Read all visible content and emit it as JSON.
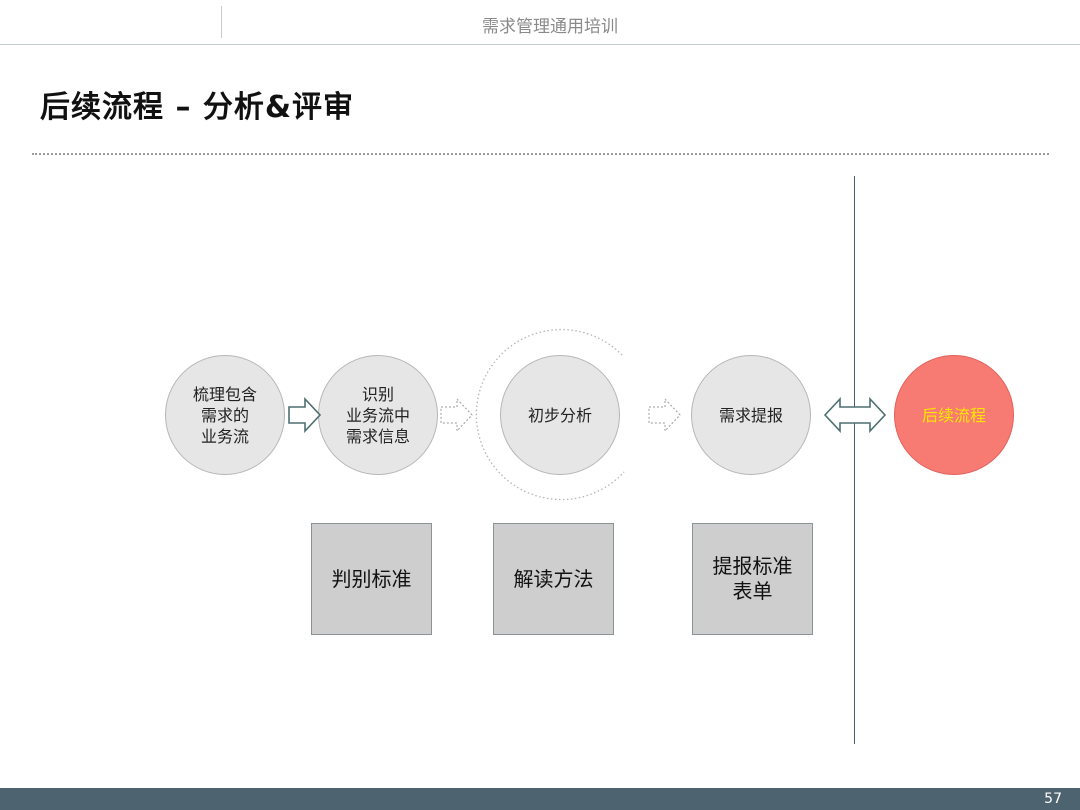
{
  "header": {
    "title": "需求管理通用培训"
  },
  "slide": {
    "title": "后续流程 – 分析&评审"
  },
  "process": {
    "steps": [
      {
        "label": "梳理包含\n需求的\n业务流"
      },
      {
        "label": "识别\n业务流中\n需求信息"
      },
      {
        "label": "初步分析"
      },
      {
        "label": "需求提报"
      },
      {
        "label": "后续流程"
      }
    ],
    "boxes": [
      {
        "label": "判别标准"
      },
      {
        "label": "解读方法"
      },
      {
        "label": "提报标准\n表单"
      }
    ]
  },
  "colors": {
    "step_fill": "#e6e6e6",
    "final_fill": "#f77a73",
    "final_text": "#ffe600",
    "box_fill": "#cecece",
    "footer": "#4e6370",
    "arrow_outline": "#4e6f70"
  },
  "footer": {
    "page_number": "57"
  }
}
